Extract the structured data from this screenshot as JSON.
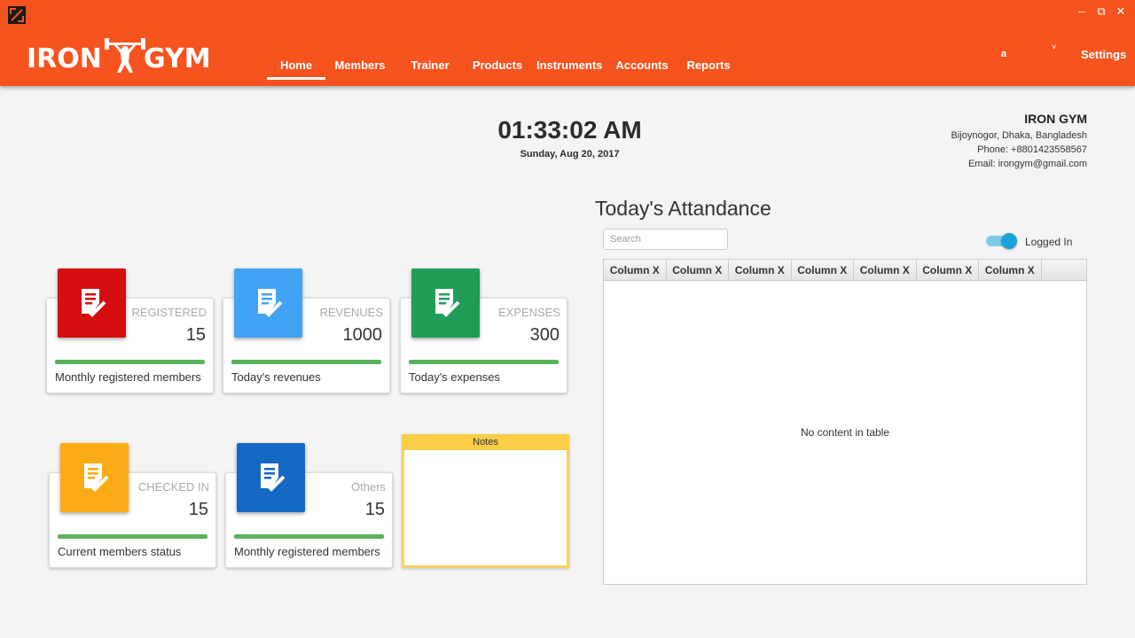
{
  "header": {
    "brand_left": "IRON",
    "brand_right": "GYM",
    "nav": [
      {
        "label": "Home"
      },
      {
        "label": "Members"
      },
      {
        "label": "Trainer"
      },
      {
        "label": "Products"
      },
      {
        "label": "Instruments"
      },
      {
        "label": "Accounts"
      },
      {
        "label": "Reports"
      }
    ],
    "user": "a",
    "settings": "Settings",
    "accent_color": "#f6531f"
  },
  "clock": {
    "time": "01:33:02 AM",
    "date": "Sunday, Aug 20, 2017"
  },
  "gym_info": {
    "name": "IRON GYM",
    "address": "Bijoynogor, Dhaka, Bangladesh",
    "phone": "Phone: +8801423558567",
    "email": "Email: irongym@gmail.com"
  },
  "cards": [
    {
      "title": "REGISTERED",
      "value": "15",
      "desc": "Monthly registered members",
      "color": "#d50f0f",
      "icon": "document-check-icon"
    },
    {
      "title": "REVENUES",
      "value": "1000",
      "desc": "Today's revenues",
      "color": "#41a3f3",
      "icon": "document-check-icon"
    },
    {
      "title": "EXPENSES",
      "value": "300",
      "desc": "Today's expenses",
      "color": "#1f9e57",
      "icon": "document-check-icon"
    },
    {
      "title": "CHECKED IN",
      "value": "15",
      "desc": "Current members status",
      "color": "#fbab15",
      "icon": "document-check-icon"
    },
    {
      "title": "Others",
      "value": "15",
      "desc": "Monthly registered members",
      "color": "#1568c4",
      "icon": "document-check-icon"
    }
  ],
  "notes": {
    "title": "Notes"
  },
  "attendance": {
    "title": "Today's Attandance",
    "search_placeholder": "Search",
    "toggle_label": "Logged In",
    "columns": [
      "Column X",
      "Column X",
      "Column X",
      "Column X",
      "Column X",
      "Column X",
      "Column X"
    ],
    "empty_text": "No content in table"
  }
}
